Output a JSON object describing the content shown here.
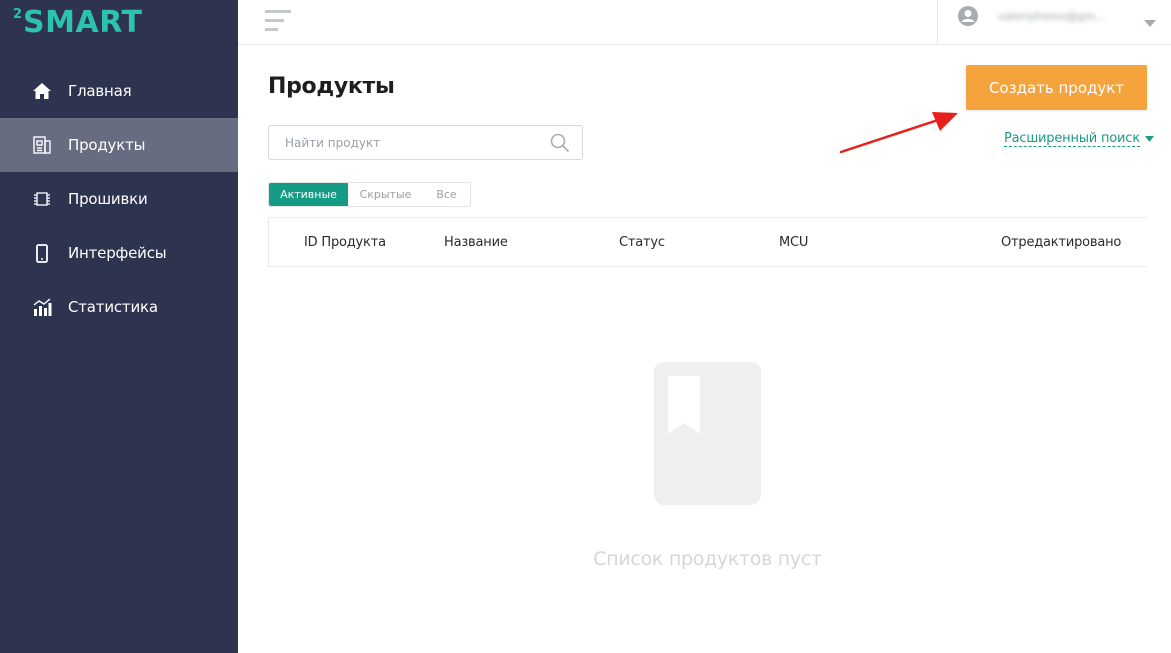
{
  "brand": {
    "sup": "2",
    "name": "SMART",
    "color": "#2bc3ac"
  },
  "sidebar": {
    "items": [
      {
        "label": "Главная",
        "icon": "home-icon",
        "active": false
      },
      {
        "label": "Продукты",
        "icon": "products-icon",
        "active": true
      },
      {
        "label": "Прошивки",
        "icon": "chip-icon",
        "active": false
      },
      {
        "label": "Интерфейсы",
        "icon": "phone-icon",
        "active": false
      },
      {
        "label": "Статистика",
        "icon": "stats-icon",
        "active": false
      }
    ]
  },
  "topbar": {
    "menu_icon": "hamburger-icon",
    "user_email": "valeriyfrolov@gm..."
  },
  "main": {
    "title": "Продукты",
    "create_button": "Создать продукт",
    "search": {
      "placeholder": "Найти продукт",
      "value": ""
    },
    "advanced_search": "Расширенный поиск",
    "tabs": [
      {
        "label": "Активные",
        "active": true
      },
      {
        "label": "Скрытые",
        "active": false
      },
      {
        "label": "Все",
        "active": false
      }
    ],
    "table": {
      "columns": [
        "ID Продукта",
        "Название",
        "Статус",
        "MCU",
        "Отредактировано"
      ]
    },
    "empty_message": "Список продуктов пуст"
  },
  "colors": {
    "sidebar_bg": "#2e3450",
    "sidebar_active": "#676c80",
    "accent_teal": "#169b86",
    "create_button": "#f5a33c",
    "annotation_arrow": "#e8201c"
  }
}
